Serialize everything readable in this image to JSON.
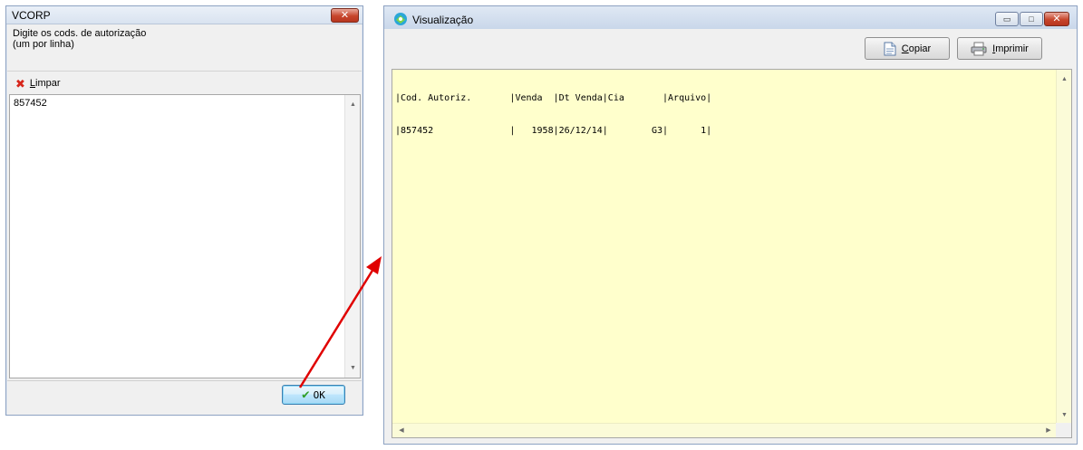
{
  "vcorp_window": {
    "title": "VCORP",
    "close_glyph": "✕",
    "instruction_line1": "Digite os cods. de autorização",
    "instruction_line2": "(um por linha)",
    "clear_button": {
      "accel": "L",
      "rest": "impar",
      "icon": "red-x-icon"
    },
    "codes_text": "857452",
    "ok_button": {
      "label": "OK",
      "icon": "green-check-icon"
    }
  },
  "preview_window": {
    "title": "Visualização",
    "controls": {
      "minimize": "▭",
      "maximize": "□",
      "close": "✕"
    },
    "copy_button": {
      "accel": "C",
      "rest": "opiar",
      "icon": "document-icon"
    },
    "print_button": {
      "accel": "I",
      "rest": "mprimir",
      "icon": "printer-icon"
    },
    "report_lines": [
      "|Cod. Autoriz.       |Venda  |Dt Venda|Cia       |Arquivo|",
      "|857452              |   1958|26/12/14|        G3|      1|"
    ]
  },
  "annotation": {
    "arrow_color": "#e00000"
  }
}
